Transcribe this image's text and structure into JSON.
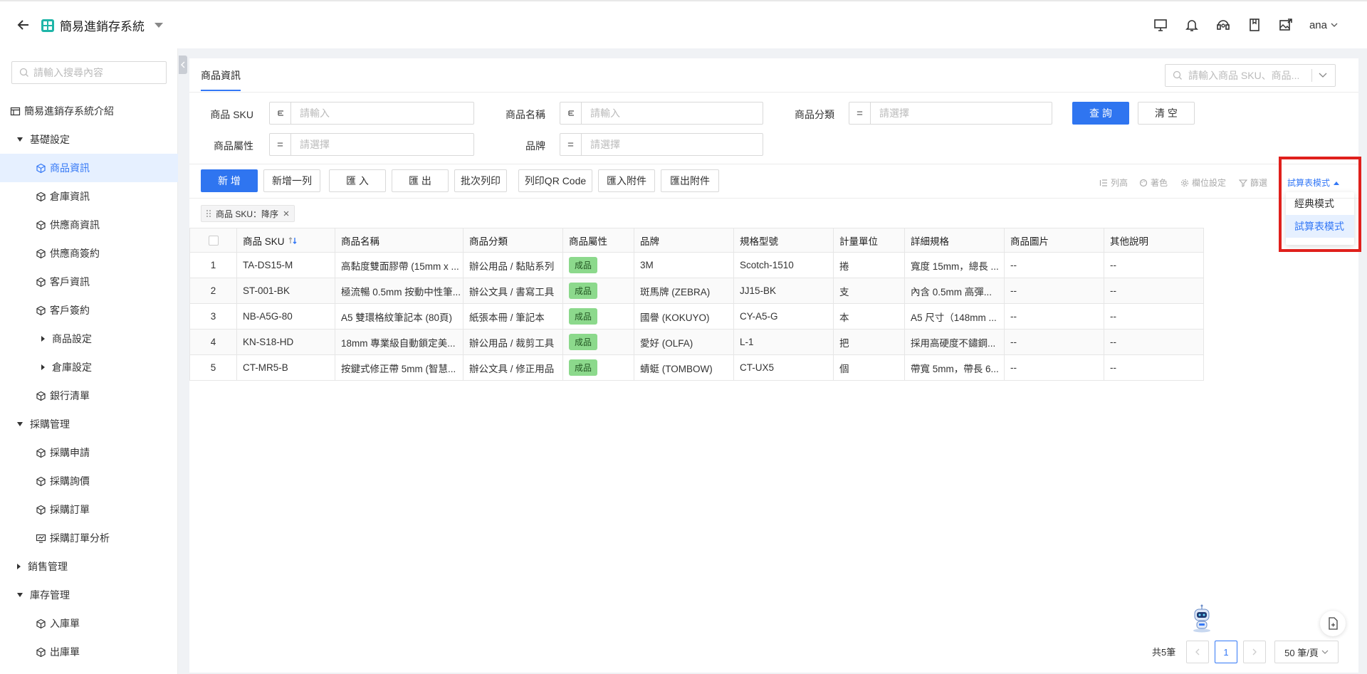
{
  "app": {
    "title": "簡易進銷存系統"
  },
  "topbar": {
    "user": "ana"
  },
  "sidebar": {
    "search_placeholder": "請輸入搜尋內容",
    "items": [
      {
        "label": "簡易進銷存系統介紹",
        "level": 0,
        "type": "doc"
      },
      {
        "label": "基礎設定",
        "level": 0,
        "type": "group-open"
      },
      {
        "label": "商品資訊",
        "level": 1,
        "type": "cube",
        "active": true
      },
      {
        "label": "倉庫資訊",
        "level": 1,
        "type": "cube"
      },
      {
        "label": "供應商資訊",
        "level": 1,
        "type": "cube"
      },
      {
        "label": "供應商簽約",
        "level": 1,
        "type": "cube"
      },
      {
        "label": "客戶資訊",
        "level": 1,
        "type": "cube"
      },
      {
        "label": "客戶簽約",
        "level": 1,
        "type": "cube"
      },
      {
        "label": "商品設定",
        "level": 2,
        "type": "group-closed"
      },
      {
        "label": "倉庫設定",
        "level": 2,
        "type": "group-closed"
      },
      {
        "label": "銀行清單",
        "level": 1,
        "type": "cube"
      },
      {
        "label": "採購管理",
        "level": 0,
        "type": "group-open"
      },
      {
        "label": "採購申請",
        "level": 1,
        "type": "cube"
      },
      {
        "label": "採購詢價",
        "level": 1,
        "type": "cube"
      },
      {
        "label": "採購訂單",
        "level": 1,
        "type": "cube"
      },
      {
        "label": "採購訂單分析",
        "level": 1,
        "type": "chart"
      },
      {
        "label": "銷售管理",
        "level": 0,
        "type": "group-closed"
      },
      {
        "label": "庫存管理",
        "level": 0,
        "type": "group-open"
      },
      {
        "label": "入庫單",
        "level": 1,
        "type": "cube"
      },
      {
        "label": "出庫單",
        "level": 1,
        "type": "cube"
      }
    ]
  },
  "main": {
    "tab": "商品資訊",
    "search_placeholder": "請輸入商品 SKU、商品...",
    "filters": {
      "sku_label": "商品 SKU",
      "sku_placeholder": "請輸入",
      "name_label": "商品名稱",
      "name_placeholder": "請輸入",
      "category_label": "商品分類",
      "category_placeholder": "請選擇",
      "attr_label": "商品屬性",
      "attr_placeholder": "請選擇",
      "brand_label": "品牌",
      "brand_placeholder": "請選擇",
      "query_button": "查 詢",
      "clear_button": "清 空"
    },
    "toolbar": {
      "add": "新 增",
      "add_row": "新增一列",
      "import": "匯 入",
      "export": "匯 出",
      "batch_print": "批次列印",
      "print_qr": "列印QR Code",
      "import_attach": "匯入附件",
      "export_attach": "匯出附件",
      "row_height": "列高",
      "color": "著色",
      "column_settings": "欄位設定",
      "filter": "篩選",
      "mode": "試算表模式"
    },
    "mode_menu": {
      "classic": "經典模式",
      "spreadsheet": "試算表模式"
    },
    "sort_tag": "商品 SKU：降序",
    "table": {
      "columns": [
        "商品 SKU",
        "商品名稱",
        "商品分類",
        "商品屬性",
        "品牌",
        "規格型號",
        "計量單位",
        "詳細規格",
        "商品圖片",
        "其他說明"
      ],
      "rows": [
        {
          "idx": "1",
          "sku": "TA-DS15-M",
          "name": "高黏度雙面膠帶 (15mm x ...",
          "category": "辦公用品 / 黏貼系列",
          "attr": "成品",
          "brand": "3M",
          "model": "Scotch-1510",
          "unit": "捲",
          "spec": "寬度 15mm，總長 ...",
          "image": "--",
          "note": "--"
        },
        {
          "idx": "2",
          "sku": "ST-001-BK",
          "name": "極流暢 0.5mm 按動中性筆...",
          "category": "辦公文具 / 書寫工具",
          "attr": "成品",
          "brand": "斑馬牌 (ZEBRA)",
          "model": "JJ15-BK",
          "unit": "支",
          "spec": "內含 0.5mm 高彈...",
          "image": "--",
          "note": "--"
        },
        {
          "idx": "3",
          "sku": "NB-A5G-80",
          "name": "A5 雙環格紋筆記本 (80頁)",
          "category": "紙張本冊 / 筆記本",
          "attr": "成品",
          "brand": "國譽 (KOKUYO)",
          "model": "CY-A5-G",
          "unit": "本",
          "spec": "A5 尺寸（148mm ...",
          "image": "--",
          "note": "--"
        },
        {
          "idx": "4",
          "sku": "KN-S18-HD",
          "name": "18mm 專業級自動鎖定美...",
          "category": "辦公用品 / 裁剪工具",
          "attr": "成品",
          "brand": "愛好 (OLFA)",
          "model": "L-1",
          "unit": "把",
          "spec": "採用高硬度不鏽鋼...",
          "image": "--",
          "note": "--"
        },
        {
          "idx": "5",
          "sku": "CT-MR5-B",
          "name": "按鍵式修正帶 5mm (智慧...",
          "category": "辦公文具 / 修正用品",
          "attr": "成品",
          "brand": "蜻蜓 (TOMBOW)",
          "model": "CT-UX5",
          "unit": "個",
          "spec": "帶寬 5mm，帶長 6...",
          "image": "--",
          "note": "--"
        }
      ]
    },
    "pagination": {
      "total": "共5筆",
      "current": "1",
      "page_size": "50 筆/頁"
    }
  }
}
